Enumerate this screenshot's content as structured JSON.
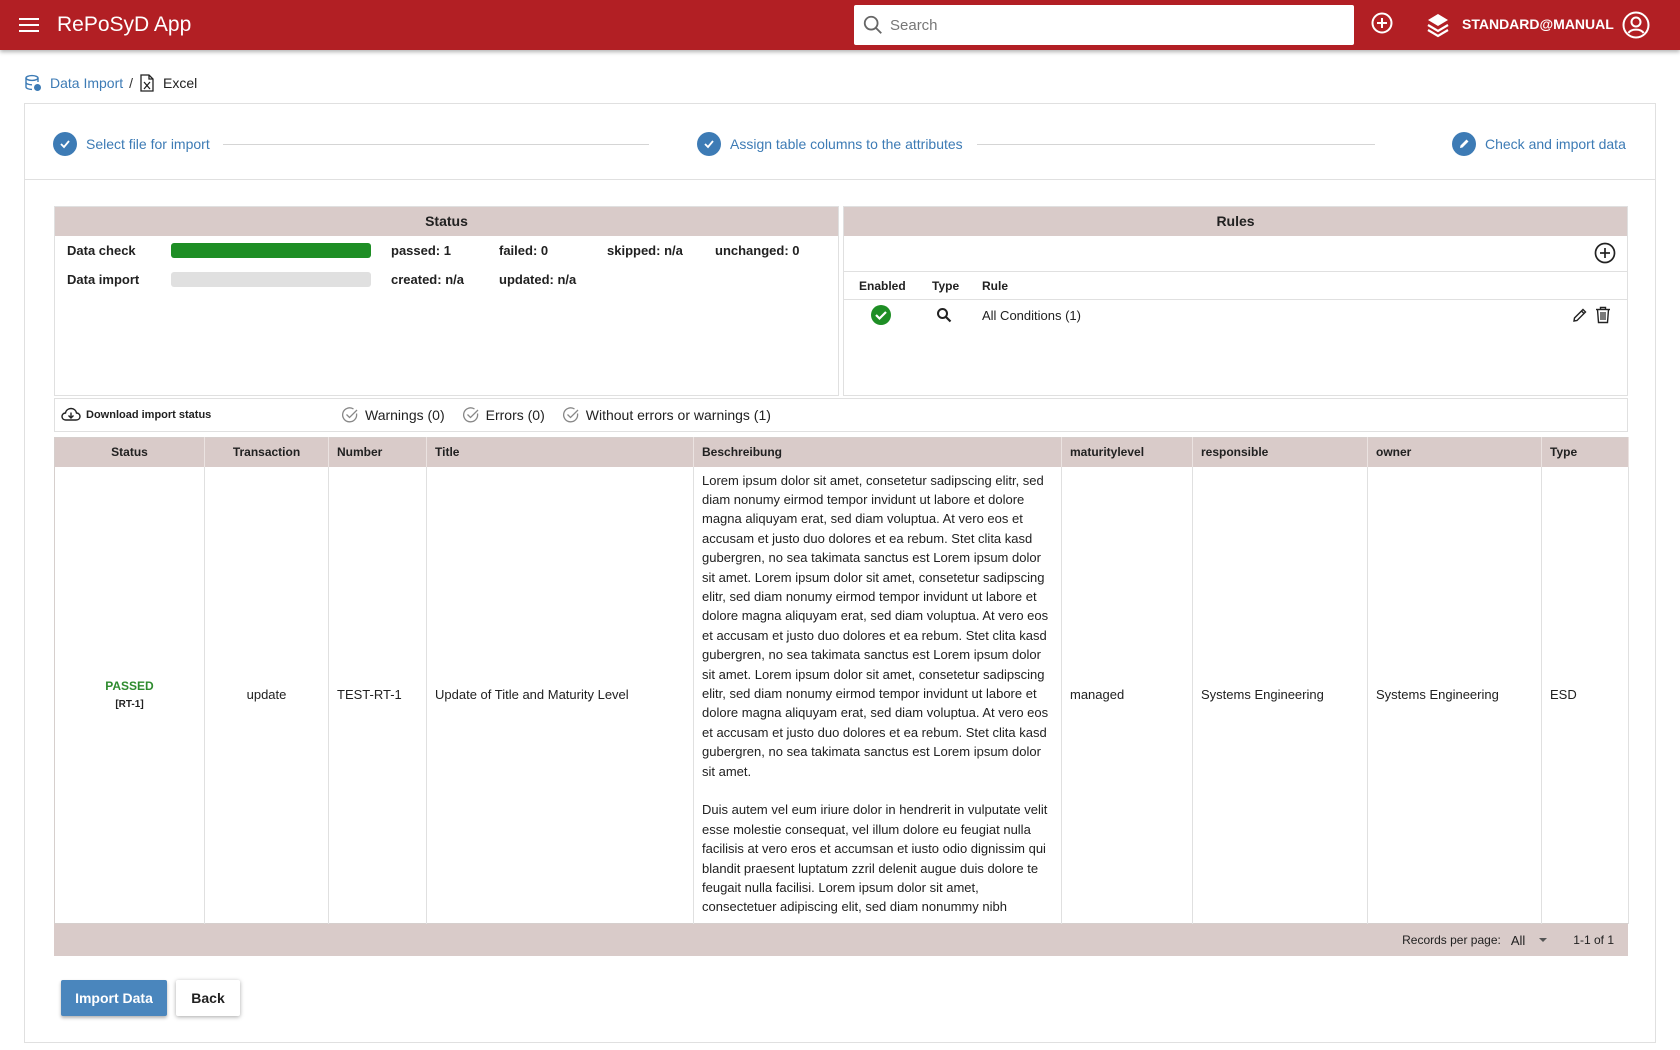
{
  "app": {
    "title": "RePoSyD App",
    "search_placeholder": "Search",
    "user_label": "STANDARD@MANUAL",
    "brand_color": "#b21f24"
  },
  "breadcrumb": {
    "root": "Data Import",
    "separator": "/",
    "current": "Excel"
  },
  "stepper": {
    "steps": [
      {
        "label": "Select file for import",
        "icon": "check-icon"
      },
      {
        "label": "Assign table columns to the attributes",
        "icon": "check-icon"
      },
      {
        "label": "Check and import data",
        "icon": "pencil-icon"
      }
    ]
  },
  "status_panel": {
    "title": "Status",
    "rows": [
      {
        "label": "Data check",
        "progress": 1.0,
        "stats": [
          "passed: 1",
          "failed: 0",
          "skipped: n/a",
          "unchanged: 0"
        ]
      },
      {
        "label": "Data import",
        "progress": 0.0,
        "stats": [
          "created: n/a",
          "updated: n/a"
        ]
      }
    ]
  },
  "rules_panel": {
    "title": "Rules",
    "columns": [
      "Enabled",
      "Type",
      "Rule"
    ],
    "rows": [
      {
        "enabled": true,
        "type_icon": "search-icon",
        "rule": "All Conditions (1)"
      }
    ]
  },
  "filter_bar": {
    "download_label": "Download import status",
    "chips": [
      "Warnings (0)",
      "Errors (0)",
      "Without errors or warnings (1)"
    ]
  },
  "table": {
    "columns": [
      "Status",
      "Transaction",
      "Number",
      "Title",
      "Beschreibung",
      "maturitylevel",
      "responsible",
      "owner",
      "Type"
    ],
    "rows": [
      {
        "status": "PASSED",
        "status_sub": "[RT-1]",
        "transaction": "update",
        "number": "TEST-RT-1",
        "title": "Update of Title and Maturity Level",
        "beschreibung": "Lorem ipsum dolor sit amet, consetetur sadipscing elitr, sed diam nonumy eirmod tempor invidunt ut labore et dolore magna aliquyam erat, sed diam voluptua. At vero eos et accusam et justo duo dolores et ea rebum. Stet clita kasd gubergren, no sea takimata sanctus est Lorem ipsum dolor sit amet. Lorem ipsum dolor sit amet, consetetur sadipscing elitr, sed diam nonumy eirmod tempor invidunt ut labore et dolore magna aliquyam erat, sed diam voluptua. At vero eos et accusam et justo duo dolores et ea rebum. Stet clita kasd gubergren, no sea takimata sanctus est Lorem ipsum dolor sit amet. Lorem ipsum dolor sit amet, consetetur sadipscing elitr, sed diam nonumy eirmod tempor invidunt ut labore et dolore magna aliquyam erat, sed diam voluptua. At vero eos et accusam et justo duo dolores et ea rebum. Stet clita kasd gubergren, no sea takimata sanctus est Lorem ipsum dolor sit amet.\n\nDuis autem vel eum iriure dolor in hendrerit in vulputate velit esse molestie consequat, vel illum dolore eu feugiat nulla facilisis at vero eros et accumsan et iusto odio dignissim qui blandit praesent luptatum zzril delenit augue duis dolore te feugait nulla facilisi. Lorem ipsum dolor sit amet, consectetuer adipiscing elit, sed diam nonummy nibh",
        "maturitylevel": "managed",
        "responsible": "Systems Engineering",
        "owner": "Systems Engineering",
        "type": "ESD"
      }
    ],
    "footer": {
      "rpp_label": "Records per page:",
      "rpp_value": "All",
      "range": "1-1 of 1"
    }
  },
  "actions": {
    "import_label": "Import Data",
    "back_label": "Back"
  }
}
